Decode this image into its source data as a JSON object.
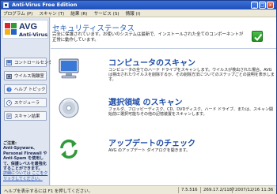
{
  "window": {
    "title": "Anti-Virus Free Edition",
    "controls": {
      "minimize": "_",
      "maximize": "□",
      "close": "x"
    }
  },
  "menu": [
    {
      "label": "プログラム (P)"
    },
    {
      "label": "スキャン (T)"
    },
    {
      "label": "結果 (R)"
    },
    {
      "label": "サービス (S)"
    },
    {
      "label": "情報 (I)"
    }
  ],
  "logo": {
    "name": "AVG",
    "subtitle": "Anti-Virus"
  },
  "sidebar": {
    "items": [
      {
        "label": "コントロールセンター",
        "icon": "control-center-icon"
      },
      {
        "label": "ウイルス隔離室",
        "icon": "virus-vault-icon"
      },
      {
        "label": "ヘルプ トピック",
        "icon": "help-icon"
      },
      {
        "label": "スケジューラ",
        "icon": "scheduler-icon"
      },
      {
        "label": "スキャン結果",
        "icon": "scan-results-icon"
      }
    ],
    "notice": {
      "title": "ご注意:",
      "body": "Anti-Spyware、Personal Firewall や Anti-Spam を使用して、保護レベルを最強化することができます。",
      "link": "詳細については ここをクリックしてください。"
    }
  },
  "status": {
    "title": "セキュリティステータス",
    "text": "完全に保護されています。お使いのシステムは最新で、インストールされた全てのコンポーネントが正常に動作しています。",
    "icon": "check-icon"
  },
  "actions": [
    {
      "title": "コンピュータのスキャン",
      "description": "コンピュータの全てのハード ドライブをスキャンします。ウイルスが検出された場合、AVG は検出されたウイルスを削除するか、その削除方法についてのステップごとの説明を表示します。",
      "icon": "computer-scan-icon"
    },
    {
      "title": "選択領域 のスキャン",
      "description": "フォルダ、フロッピーディスク、CD、DVDディスク、ハード ドライブ、または、スキャン開始前に選択可能なその他の記憶装置をスキャンします。",
      "icon": "selected-area-scan-icon"
    },
    {
      "title": "アップデートのチェック",
      "description": "AVG のアップデート ダイアログを開きます。",
      "icon": "update-icon"
    }
  ],
  "statusbar": {
    "help": "ヘルプを表示するには F1 を押してください。",
    "version": "7.5.516",
    "database": "269.17.2/1187",
    "date": "2007/12/16 11:36"
  },
  "colors": {
    "accent": "#2a5db0",
    "title_bar": "#1f4fb8",
    "status_ok": "#1e8f1e"
  }
}
